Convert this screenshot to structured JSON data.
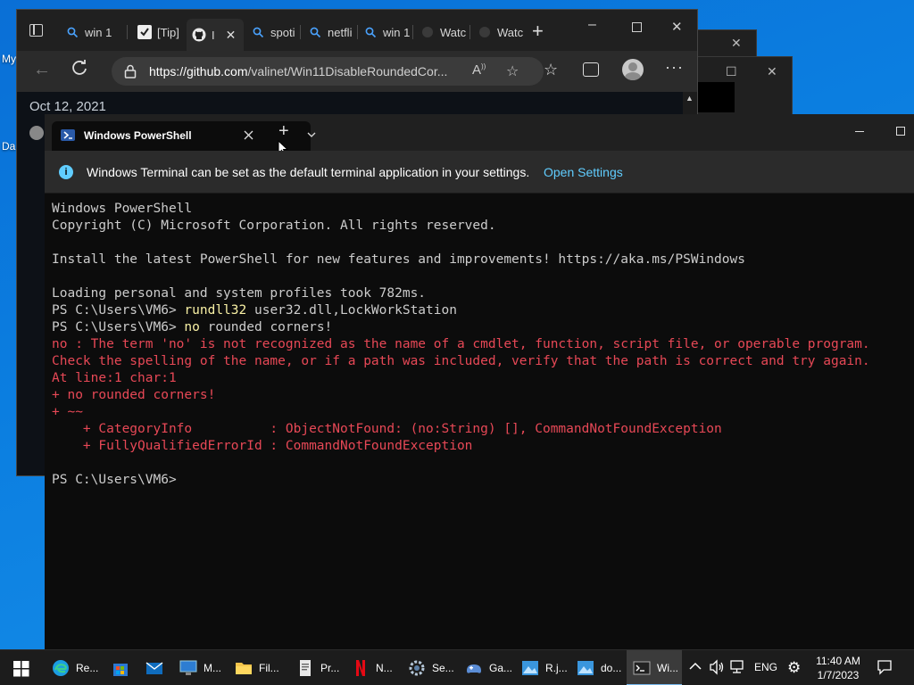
{
  "desktop": {
    "icon_labels": [
      "My",
      "Da"
    ]
  },
  "browser": {
    "tabs": [
      {
        "label": "win 1",
        "icon": "search-icon"
      },
      {
        "label": "[Tip]",
        "icon": "check-logo-icon"
      },
      {
        "label": "I",
        "icon": "github-icon",
        "active": true
      },
      {
        "label": "spoti",
        "icon": "search-icon"
      },
      {
        "label": "netfli",
        "icon": "search-icon"
      },
      {
        "label": "win 1",
        "icon": "search-icon"
      },
      {
        "label": "Watc",
        "icon": "circle-icon"
      },
      {
        "label": "Watc",
        "icon": "circle-icon"
      }
    ],
    "new_tab": "+",
    "url_host": "https://github.com",
    "url_path": "/valinet/Win11DisableRoundedCor...",
    "content_date": "Oct 12, 2021"
  },
  "terminal": {
    "tab_title": "Windows PowerShell",
    "new_tab": "+",
    "info_message": "Windows Terminal can be set as the default terminal application in your settings.",
    "info_link": "Open Settings",
    "lines": [
      {
        "t": "Windows PowerShell",
        "c": "out"
      },
      {
        "t": "Copyright (C) Microsoft Corporation. All rights reserved.",
        "c": "out"
      },
      {
        "t": "",
        "c": "out"
      },
      {
        "t": "Install the latest PowerShell for new features and improvements! https://aka.ms/PSWindows",
        "c": "out"
      },
      {
        "t": "",
        "c": "out"
      },
      {
        "t": "Loading personal and system profiles took 782ms.",
        "c": "out"
      },
      {
        "t": "PS C:\\Users\\VM6> ",
        "cmd": "rundll32",
        "rest": " user32.dll,LockWorkStation",
        "c": "prompt"
      },
      {
        "t": "PS C:\\Users\\VM6> ",
        "cmd": "no",
        "rest": " rounded corners!",
        "c": "prompt"
      },
      {
        "t": "no : The term 'no' is not recognized as the name of a cmdlet, function, script file, or operable program.",
        "c": "err"
      },
      {
        "t": "Check the spelling of the name, or if a path was included, verify that the path is correct and try again.",
        "c": "err"
      },
      {
        "t": "At line:1 char:1",
        "c": "err"
      },
      {
        "t": "+ no rounded corners!",
        "c": "err"
      },
      {
        "t": "+ ~~",
        "c": "err"
      },
      {
        "t": "    + CategoryInfo          : ObjectNotFound: (no:String) [], CommandNotFoundException",
        "c": "err"
      },
      {
        "t": "    + FullyQualifiedErrorId : CommandNotFoundException",
        "c": "err"
      },
      {
        "t": "",
        "c": "out"
      },
      {
        "t": "PS C:\\Users\\VM6>",
        "c": "out"
      }
    ]
  },
  "taskbar": {
    "apps": [
      {
        "label": "Re...",
        "icon": "edge-icon"
      },
      {
        "label": "",
        "icon": "store-icon"
      },
      {
        "label": "",
        "icon": "mail-icon"
      },
      {
        "label": "M...",
        "icon": "monitor-icon"
      },
      {
        "label": "Fil...",
        "icon": "folder-icon"
      },
      {
        "label": "Pr...",
        "icon": "document-icon"
      },
      {
        "label": "N...",
        "icon": "netflix-icon"
      },
      {
        "label": "Se...",
        "icon": "settings-icon"
      },
      {
        "label": "Ga...",
        "icon": "game-icon"
      },
      {
        "label": "R.j...",
        "icon": "image-icon"
      },
      {
        "label": "do...",
        "icon": "image-icon"
      },
      {
        "label": "Wi...",
        "icon": "terminal-icon",
        "active": true
      }
    ],
    "language": "ENG",
    "time": "11:40 AM",
    "date": "1/7/2023"
  }
}
